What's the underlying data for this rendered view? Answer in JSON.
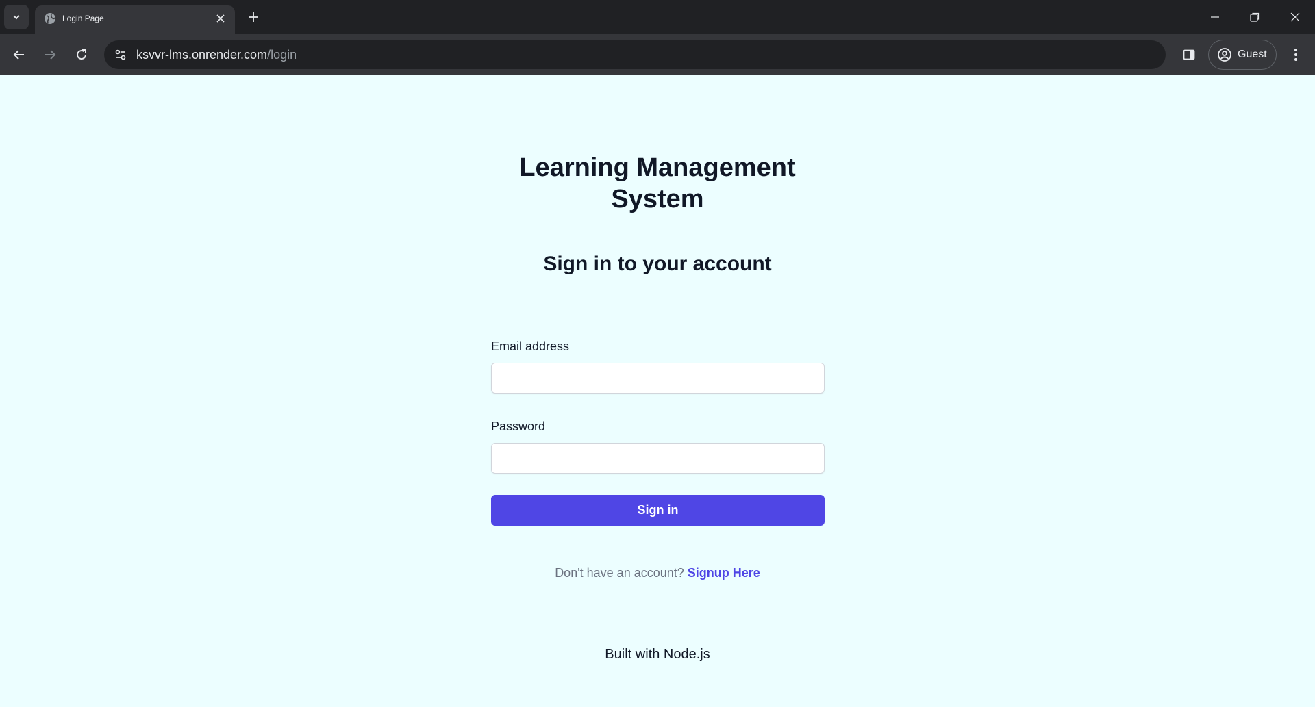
{
  "browser": {
    "tab_title": "Login Page",
    "url_host": "ksvvr-lms.onrender.com",
    "url_path": "/login",
    "profile_label": "Guest"
  },
  "page": {
    "title_line1": "Learning Management",
    "title_line2": "System",
    "heading": "Sign in to your account",
    "email_label": "Email address",
    "email_value": "",
    "password_label": "Password",
    "password_value": "",
    "signin_label": "Sign in",
    "signup_prompt": "Don't have an account?",
    "signup_link": "Signup Here",
    "footer": "Built with Node.js"
  },
  "colors": {
    "page_background": "#ecfeff",
    "accent": "#4f46e5",
    "chrome_dark": "#202124",
    "chrome_toolbar": "#35363a"
  }
}
